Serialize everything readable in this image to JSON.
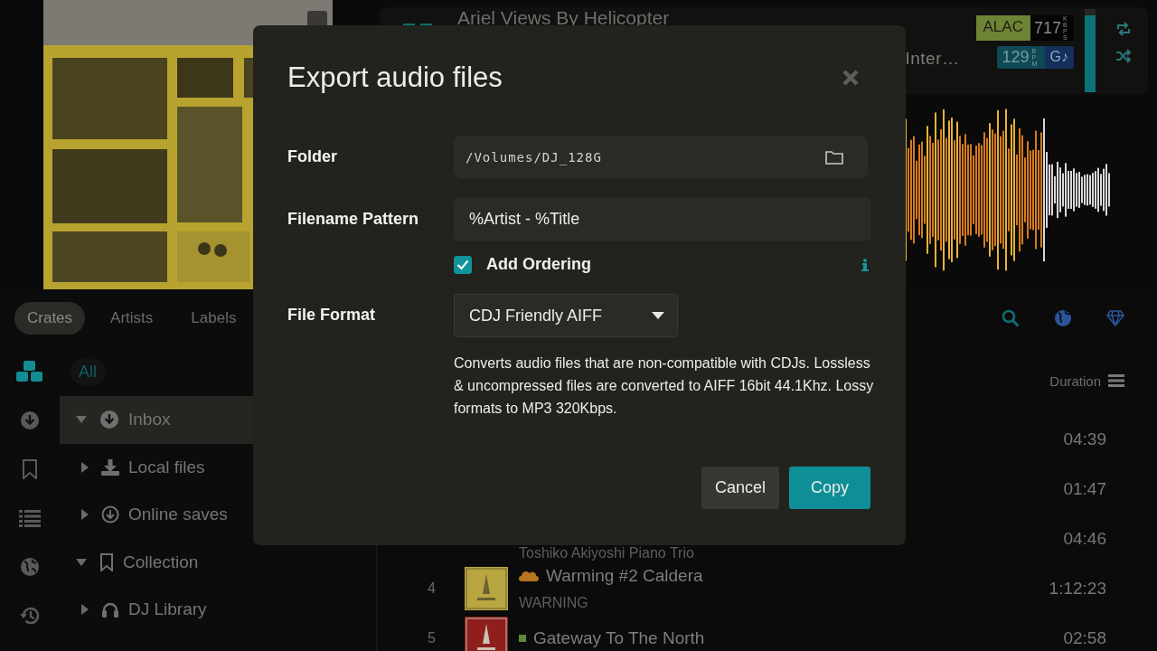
{
  "now_playing": {
    "title": "Ariel Views By Helicopter",
    "subtitle": "Inter…",
    "format": "ALAC",
    "bitrate": "717",
    "bitrate_unit": "KBPS",
    "bpm": "129",
    "bpm_unit": "BPM",
    "key": "G♪",
    "volume": {
      "level": 0.92
    }
  },
  "browser_tabs": [
    {
      "label": "Crates",
      "selected": true
    },
    {
      "label": "Artists",
      "selected": false
    },
    {
      "label": "Labels",
      "selected": false
    }
  ],
  "rail": [
    {
      "kind": "crates",
      "selected": true
    },
    {
      "kind": "inbox",
      "selected": false
    },
    {
      "kind": "collection",
      "selected": false
    },
    {
      "kind": "playlists",
      "selected": false
    },
    {
      "kind": "online",
      "selected": false
    },
    {
      "kind": "history",
      "selected": false
    }
  ],
  "filter": {
    "label": "All"
  },
  "tree": [
    {
      "label": "Inbox",
      "kind": "inbox",
      "expanded": true,
      "selected": true,
      "children": [
        {
          "label": "Local files",
          "kind": "local",
          "expanded": false,
          "selected": false
        },
        {
          "label": "Online saves",
          "kind": "online",
          "expanded": false,
          "selected": false
        }
      ]
    },
    {
      "label": "Collection",
      "kind": "collection",
      "expanded": true,
      "selected": false,
      "children": [
        {
          "label": "DJ Library",
          "kind": "library",
          "expanded": false,
          "selected": false
        }
      ]
    }
  ],
  "tracks": {
    "columns": [
      {
        "label": "Duration"
      }
    ],
    "rows": [
      {
        "duration": "04:39"
      },
      {
        "duration": "01:47"
      },
      {
        "artist": "Toshiko Akiyoshi Piano Trio",
        "duration": "04:46"
      },
      {
        "number": "4",
        "kind": "cloud",
        "title": "Warming #2 Caldera",
        "artist": "WARNING",
        "duration": "1:12:23"
      },
      {
        "number": "5",
        "kind": "local",
        "title": "Gateway To The North",
        "duration": "02:58"
      }
    ]
  },
  "dialog": {
    "title": "Export audio files",
    "fields": [
      {
        "kind": "path",
        "label": "Folder",
        "value": "/Volumes/DJ_128G"
      },
      {
        "kind": "text",
        "label": "Filename Pattern",
        "value": "%Artist - %Title"
      }
    ],
    "option": {
      "label": "Add Ordering",
      "checked": true
    },
    "format": {
      "label": "File Format",
      "value": "CDJ Friendly AIFF",
      "description": "Converts audio files that are non-compatible with CDJs. Lossless & uncompressed files are converted to AIFF 16bit 44.1Khz. Lossy formats to MP3 320Kbps."
    },
    "buttons": [
      {
        "label": "Cancel",
        "kind": "secondary"
      },
      {
        "label": "Copy",
        "kind": "primary"
      }
    ]
  }
}
